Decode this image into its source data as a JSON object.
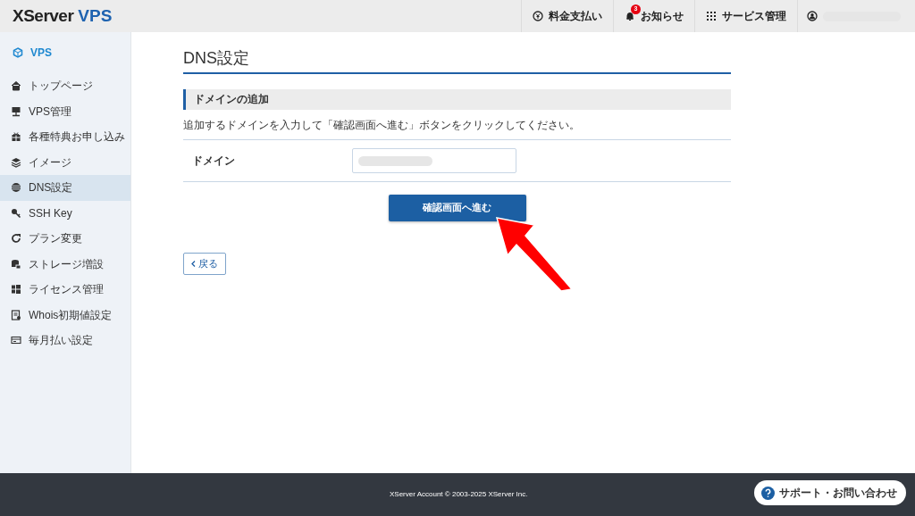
{
  "header": {
    "brand": {
      "name": "XServer",
      "product": "VPS"
    },
    "nav": [
      {
        "kind": "yen",
        "label": "料金支払い"
      },
      {
        "kind": "bell",
        "label": "お知らせ",
        "badge": "3"
      },
      {
        "kind": "grid",
        "label": "サービス管理"
      }
    ],
    "account": {
      "kind": "user"
    }
  },
  "sidebar": {
    "title": "VPS",
    "items": [
      {
        "kind": "home",
        "label": "トップページ",
        "selected": false
      },
      {
        "kind": "server",
        "label": "VPS管理",
        "selected": false
      },
      {
        "kind": "gift",
        "label": "各種特典お申し込み",
        "selected": false
      },
      {
        "kind": "layers",
        "label": "イメージ",
        "selected": false
      },
      {
        "kind": "globe",
        "label": "DNS設定",
        "selected": true
      },
      {
        "kind": "key",
        "label": "SSH Key",
        "selected": false
      },
      {
        "kind": "refresh",
        "label": "プラン変更",
        "selected": false
      },
      {
        "kind": "storage",
        "label": "ストレージ増設",
        "selected": false
      },
      {
        "kind": "windows",
        "label": "ライセンス管理",
        "selected": false
      },
      {
        "kind": "doc",
        "label": "Whois初期値設定",
        "selected": false
      },
      {
        "kind": "card",
        "label": "毎月払い設定",
        "selected": false
      }
    ]
  },
  "page": {
    "title": "DNS設定",
    "section": "ドメインの追加",
    "description": "追加するドメインを入力して「確認画面へ進む」ボタンをクリックしてください。",
    "form": [
      {
        "label": "ドメイン"
      }
    ],
    "submit": "確認画面へ進む",
    "back": "戻る"
  },
  "footer": {
    "copyright": "XServer Account © 2003-2025 XServer Inc.",
    "support": "サポート・お問い合わせ"
  }
}
